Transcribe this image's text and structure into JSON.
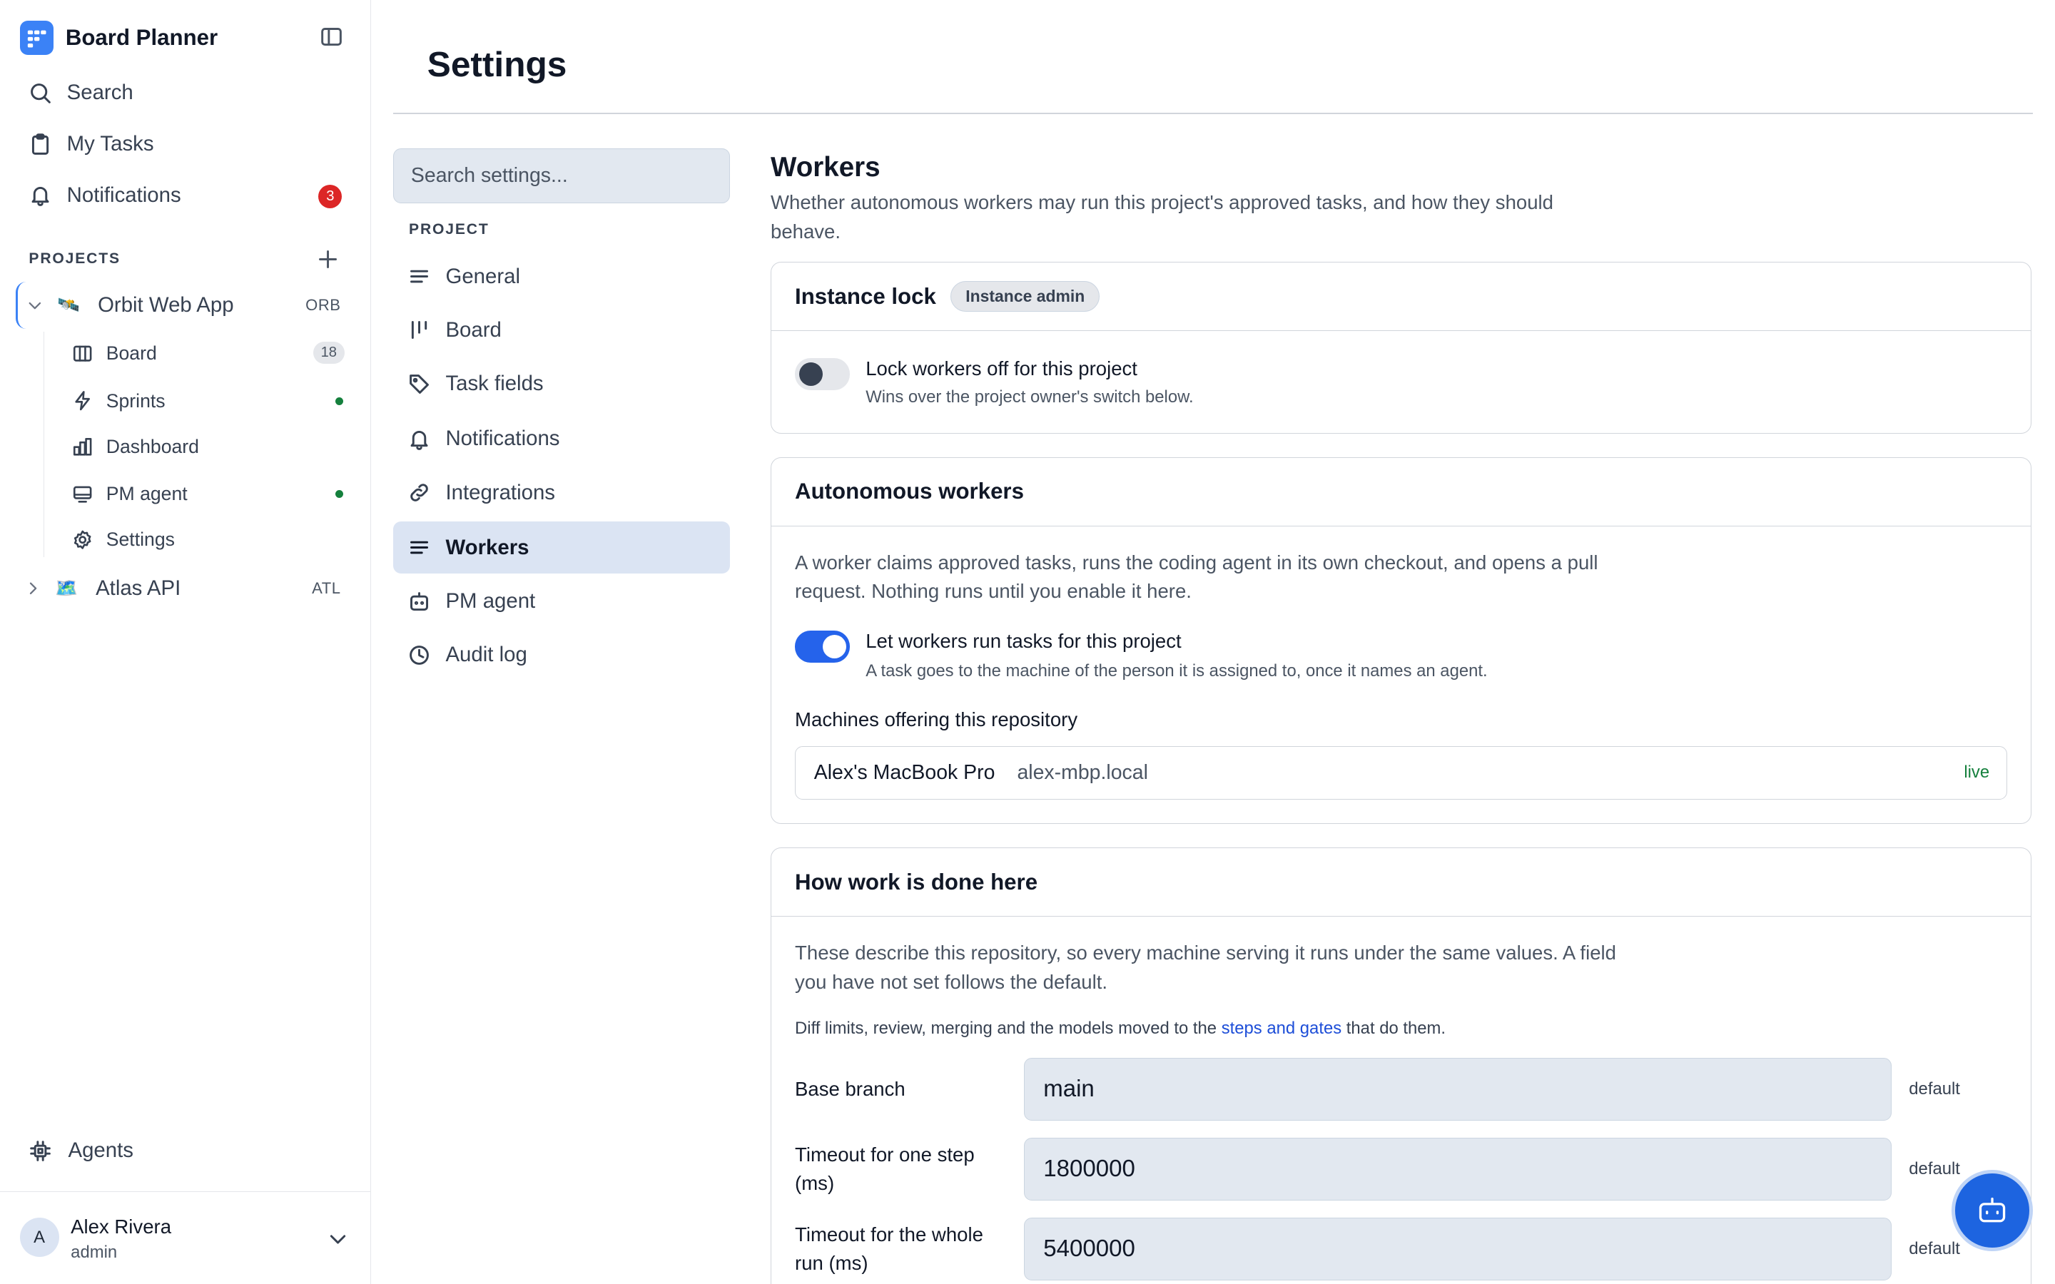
{
  "app": {
    "name": "Board Planner"
  },
  "sidebar": {
    "nav": [
      {
        "label": "Search",
        "icon": "search-icon"
      },
      {
        "label": "My Tasks",
        "icon": "clipboard-icon"
      },
      {
        "label": "Notifications",
        "icon": "bell-icon",
        "badge": "3"
      }
    ],
    "projects_label": "PROJECTS",
    "projects": [
      {
        "name": "Orbit Web App",
        "code": "ORB",
        "expanded": true,
        "children": [
          {
            "label": "Board",
            "icon": "board-icon",
            "count": "18"
          },
          {
            "label": "Sprints",
            "icon": "bolt-icon",
            "dot": true
          },
          {
            "label": "Dashboard",
            "icon": "chart-icon"
          },
          {
            "label": "PM agent",
            "icon": "monitor-icon",
            "dot": true
          },
          {
            "label": "Settings",
            "icon": "gear-icon"
          }
        ]
      },
      {
        "name": "Atlas API",
        "code": "ATL",
        "expanded": false
      }
    ],
    "agents_label": "Agents",
    "user": {
      "initial": "A",
      "name": "Alex Rivera",
      "role": "admin"
    }
  },
  "settings": {
    "title": "Settings",
    "search_placeholder": "Search settings...",
    "section_label": "PROJECT",
    "nav": [
      "General",
      "Board",
      "Task fields",
      "Notifications",
      "Integrations",
      "Workers",
      "PM agent",
      "Audit log"
    ],
    "selected": "Workers"
  },
  "workers": {
    "title": "Workers",
    "description": "Whether autonomous workers may run this project's approved tasks, and how they should behave.",
    "instance_lock": {
      "title": "Instance lock",
      "badge": "Instance admin",
      "toggle_label": "Lock workers off for this project",
      "toggle_sub": "Wins over the project owner's switch below.",
      "enabled": false
    },
    "autonomous": {
      "title": "Autonomous workers",
      "paragraph": "A worker claims approved tasks, runs the coding agent in its own checkout, and opens a pull request. Nothing runs until you enable it here.",
      "toggle_label": "Let workers run tasks for this project",
      "toggle_sub": "A task goes to the machine of the person it is assigned to, once it names an agent.",
      "enabled": true,
      "machines_heading": "Machines offering this repository",
      "machines": [
        {
          "name": "Alex's MacBook Pro",
          "host": "alex-mbp.local",
          "status": "live"
        }
      ]
    },
    "how": {
      "title": "How work is done here",
      "paragraph": "These describe this repository, so every machine serving it runs under the same values. A field you have not set follows the default.",
      "note_before": "Diff limits, review, merging and the models moved to the ",
      "note_link": "steps and gates",
      "note_after": " that do them.",
      "fields": [
        {
          "label": "Base branch",
          "value": "main",
          "hint": "default"
        },
        {
          "label": "Timeout for one step (ms)",
          "value": "1800000",
          "hint": "default"
        },
        {
          "label": "Timeout for the whole run (ms)",
          "value": "5400000",
          "hint": "default"
        }
      ]
    }
  },
  "colors": {
    "accent": "#2563eb",
    "selected_bg": "#dbe4f3",
    "badge": "#dc2626",
    "live": "#15803d"
  }
}
